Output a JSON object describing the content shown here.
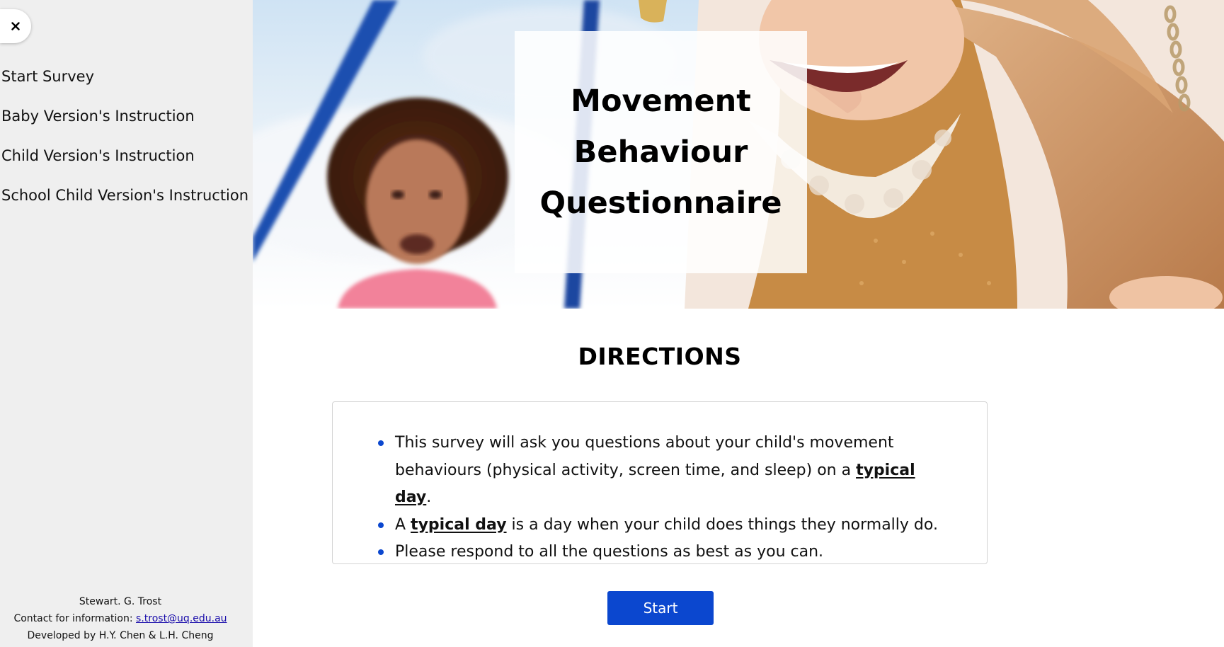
{
  "sidebar": {
    "close_label": "×",
    "items": [
      {
        "label": "Start Survey"
      },
      {
        "label": "Baby Version's Instruction"
      },
      {
        "label": "Child Version's Instruction"
      },
      {
        "label": "School Child Version's Instruction"
      }
    ],
    "footer": {
      "author": "Stewart. G. Trost",
      "contact_prefix": "Contact for information: ",
      "contact_email": "s.trost@uq.edu.au",
      "developed_by": "Developed by H.Y. Chen & L.H. Cheng"
    }
  },
  "hero": {
    "title_line1": "Movement",
    "title_line2": "Behaviour",
    "title_line3": "Questionnaire",
    "image_icon": "children-on-swings-photo"
  },
  "directions": {
    "heading": "DIRECTIONS",
    "items": [
      {
        "text_before": "This survey will ask you questions about your child's movement behaviours (physical activity, screen time, and sleep) on a ",
        "emphasis": "typical day",
        "text_after": "."
      },
      {
        "text_before": "A ",
        "emphasis": "typical day",
        "text_after": " is a day when your child does things they normally do."
      },
      {
        "text_before": "Please respond to all the questions as best as you can.",
        "emphasis": "",
        "text_after": ""
      }
    ]
  },
  "start_button": {
    "label": "Start"
  },
  "colors": {
    "accent": "#0b47cf",
    "sidebar_bg": "#efefef",
    "card_border": "#d4d4d4"
  }
}
